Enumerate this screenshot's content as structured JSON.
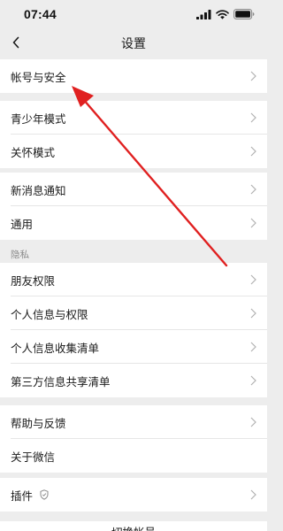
{
  "status_bar": {
    "time": "07:44",
    "icons": [
      "signal-icon",
      "wifi-icon",
      "battery-icon"
    ]
  },
  "nav": {
    "back_icon": "chevron-left-icon",
    "title": "设置"
  },
  "groups": {
    "g1": {
      "items": [
        {
          "label": "帐号与安全"
        }
      ]
    },
    "g2": {
      "items": [
        {
          "label": "青少年模式"
        },
        {
          "label": "关怀模式"
        }
      ]
    },
    "g3": {
      "items": [
        {
          "label": "新消息通知"
        },
        {
          "label": "通用"
        }
      ]
    },
    "privacy": {
      "section_label": "隐私",
      "items": [
        {
          "label": "朋友权限"
        },
        {
          "label": "个人信息与权限"
        },
        {
          "label": "个人信息收集清单"
        },
        {
          "label": "第三方信息共享清单"
        }
      ]
    },
    "g5": {
      "items": [
        {
          "label": "帮助与反馈"
        },
        {
          "label": "关于微信"
        }
      ]
    },
    "g6": {
      "items": [
        {
          "label": "插件",
          "badge_icon": "shield-icon"
        }
      ]
    }
  },
  "footer": {
    "partial_label": "切换帐号"
  },
  "colors": {
    "background": "#ededed",
    "row_background": "#ffffff",
    "annotation_arrow": "#e02020",
    "chevron": "#b2b2b2"
  }
}
